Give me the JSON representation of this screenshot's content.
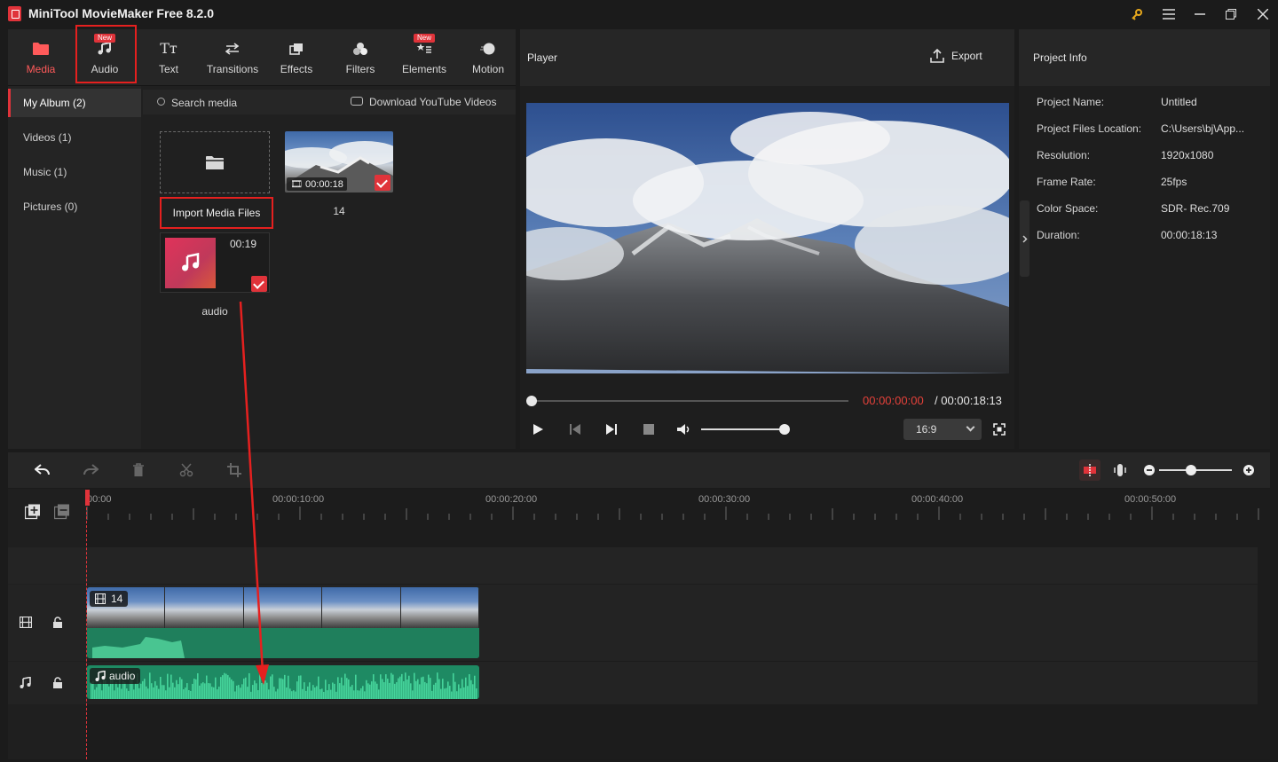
{
  "app": {
    "title": "MiniTool MovieMaker Free 8.2.0"
  },
  "toolbar": {
    "tabs": [
      {
        "label": "Media",
        "badge": ""
      },
      {
        "label": "Audio",
        "badge": "New"
      },
      {
        "label": "Text",
        "badge": ""
      },
      {
        "label": "Transitions",
        "badge": ""
      },
      {
        "label": "Effects",
        "badge": ""
      },
      {
        "label": "Filters",
        "badge": ""
      },
      {
        "label": "Elements",
        "badge": "New"
      },
      {
        "label": "Motion",
        "badge": ""
      }
    ],
    "active_tab": "Media"
  },
  "album": {
    "items": [
      {
        "label": "My Album (2)"
      },
      {
        "label": "Videos (1)"
      },
      {
        "label": "Music (1)"
      },
      {
        "label": "Pictures (0)"
      }
    ]
  },
  "media": {
    "search_placeholder": "Search media",
    "youtube_label": "Download YouTube Videos",
    "import_label": "Import Media Files",
    "video": {
      "name": "14",
      "duration": "00:00:18"
    },
    "audio": {
      "name": "audio",
      "duration": "00:19"
    }
  },
  "player": {
    "title": "Player",
    "export_label": "Export",
    "time_current": "00:00:00:00",
    "time_total": "/ 00:00:18:13",
    "aspect_ratio": "16:9",
    "seek_progress": 0,
    "volume_level": 0.95
  },
  "project_info": {
    "title": "Project Info",
    "rows": [
      {
        "key": "Project Name:",
        "value": "Untitled"
      },
      {
        "key": "Project Files Location:",
        "value": "C:\\Users\\bj\\App..."
      },
      {
        "key": "Resolution:",
        "value": "1920x1080"
      },
      {
        "key": "Frame Rate:",
        "value": "25fps"
      },
      {
        "key": "Color Space:",
        "value": "SDR- Rec.709"
      },
      {
        "key": "Duration:",
        "value": "00:00:18:13"
      }
    ]
  },
  "timeline": {
    "ruler_labels": [
      "00:00",
      "00:00:10:00",
      "00:00:20:00",
      "00:00:30:00",
      "00:00:40:00",
      "00:00:50:00"
    ],
    "video_clip_label": "14",
    "audio_clip_label": "audio",
    "zoom_level": 0.45
  },
  "colors": {
    "accent": "#e0333a",
    "clip_green": "#1e8a63",
    "annotation": "#e5201f"
  }
}
